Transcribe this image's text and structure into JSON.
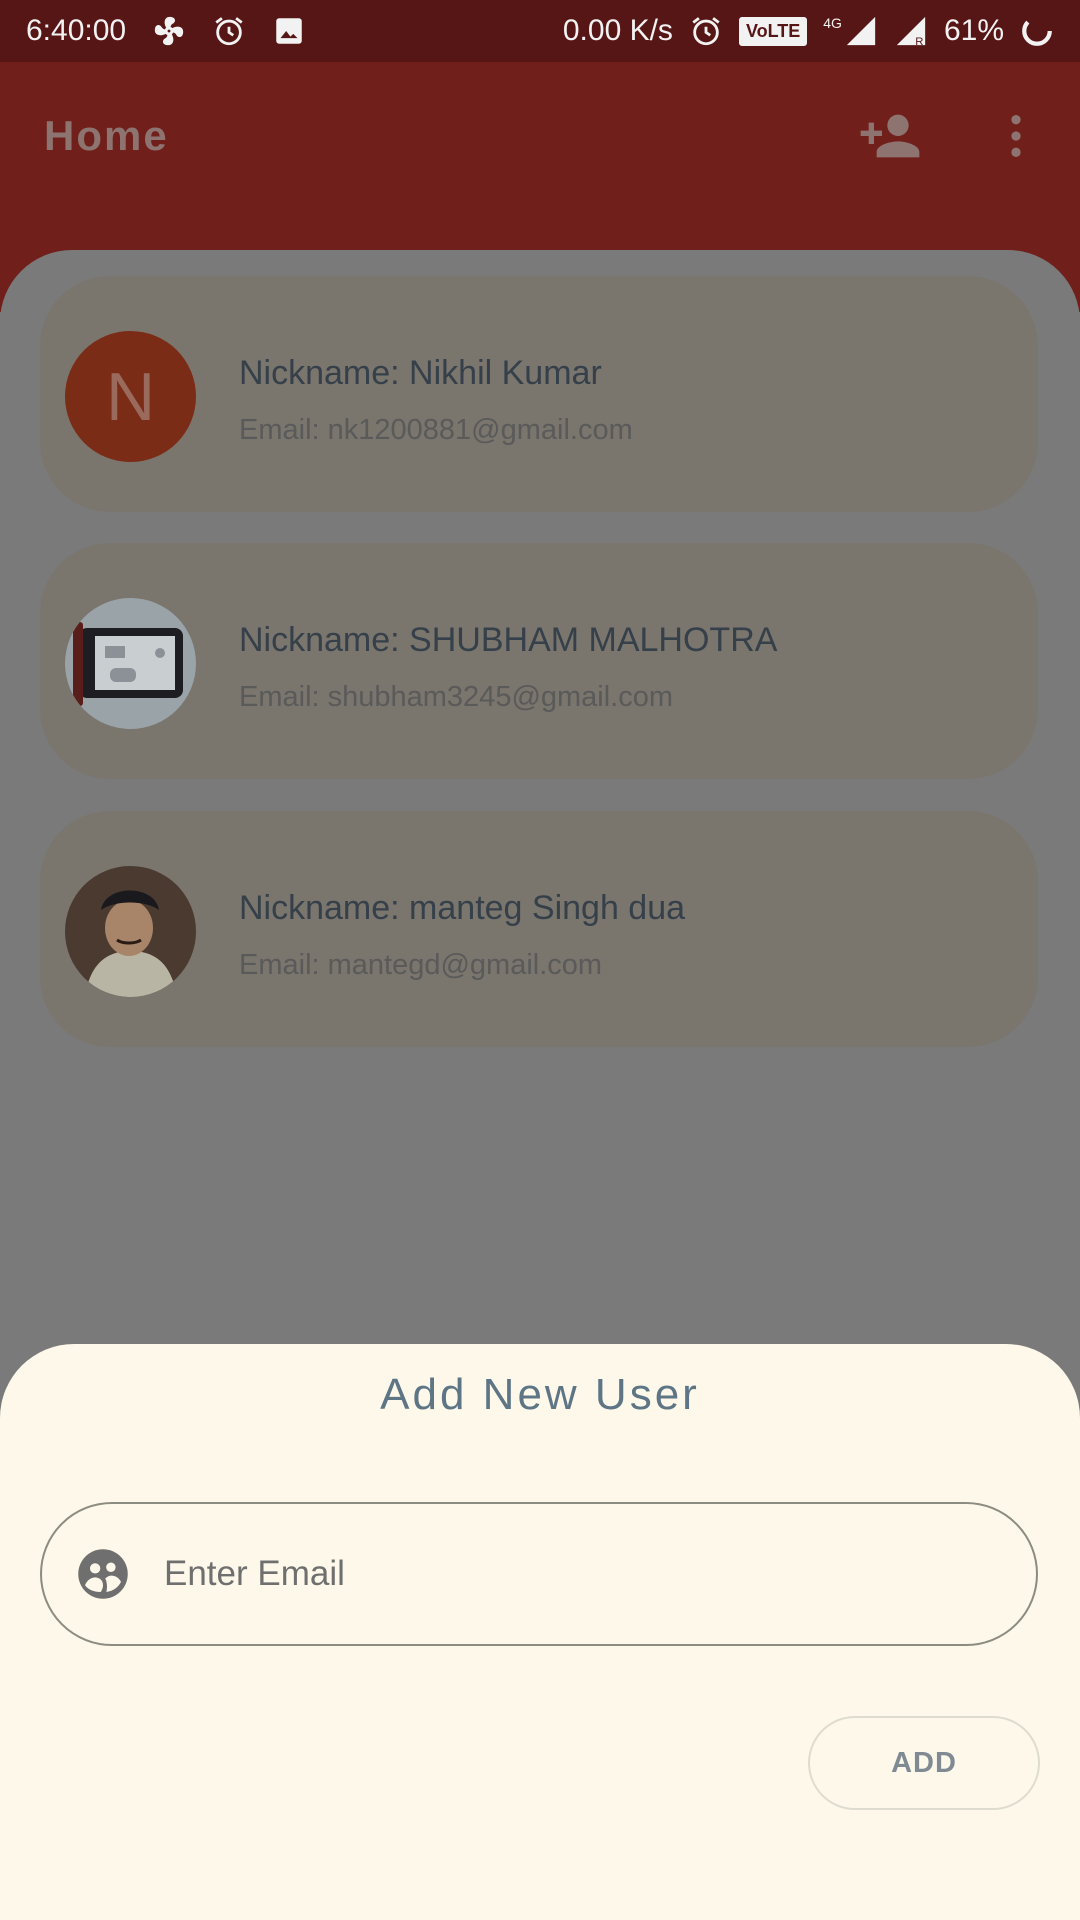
{
  "status_bar": {
    "time": "6:40:00",
    "net_speed": "0.00 K/s",
    "volte": "VoLTE",
    "network": "4G",
    "battery": "61%"
  },
  "app_bar": {
    "title": "Home",
    "icons": [
      "add-user-icon",
      "more-vert-icon"
    ]
  },
  "users": [
    {
      "nickname": "Nickname: Nikhil Kumar",
      "email": "Email: nk1200881@gmail.com",
      "avatar_letter": "N"
    },
    {
      "nickname": "Nickname: SHUBHAM MALHOTRA",
      "email": "Email: shubham3245@gmail.com"
    },
    {
      "nickname": "Nickname: manteg Singh dua",
      "email": "Email: mantegd@gmail.com"
    }
  ],
  "sheet": {
    "title": "Add New User",
    "email_placeholder": "Enter Email",
    "email_value": "",
    "add_label": "ADD"
  },
  "colors": {
    "status_bar": "#571616",
    "app_bar": "#711f1b",
    "sheet_bg": "#fdf8ea",
    "title_color": "#5e7585"
  }
}
